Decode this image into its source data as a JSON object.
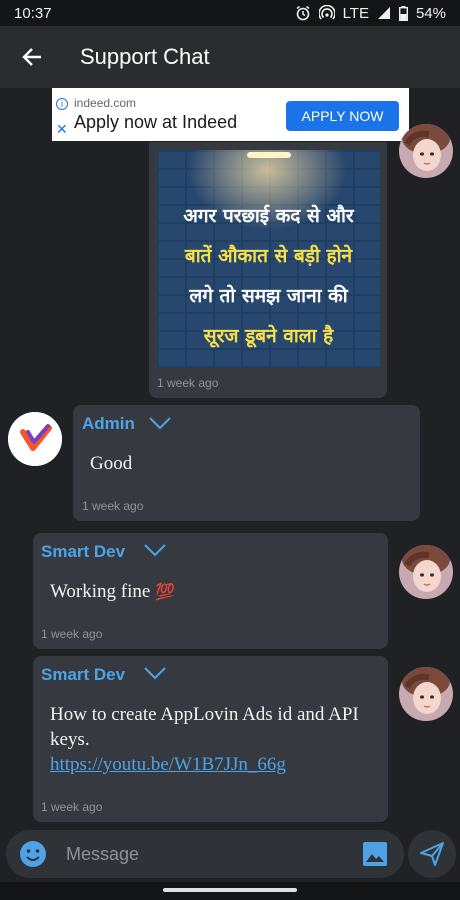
{
  "status_bar": {
    "time": "10:37",
    "network": "LTE",
    "battery": "54%"
  },
  "app_bar": {
    "title": "Support Chat"
  },
  "ad": {
    "domain": "indeed.com",
    "headline": "Apply now at Indeed",
    "cta": "APPLY NOW"
  },
  "messages": [
    {
      "image_text": [
        "अगर परछाई कद से और",
        "बातें औकात से बड़ी होने",
        "लगे तो समझ जाना की",
        "सूरज डूबने वाला है"
      ],
      "time": "1 week ago"
    },
    {
      "sender": "Admin",
      "text": "Good",
      "time": "1 week ago"
    },
    {
      "sender": "Smart Dev",
      "text": "Working fine",
      "emoji": "💯",
      "time": "1 week ago"
    },
    {
      "sender": "Smart Dev",
      "text": "How to create AppLovin Ads id and API keys.",
      "link": "https://youtu.be/W1B7JJn_66g",
      "time": "1 week ago"
    }
  ],
  "composer": {
    "placeholder": "Message"
  },
  "colors": {
    "accent": "#4ea3e6",
    "background": "#1f2124",
    "bubble": "#363a40",
    "poster_yellow": "#f5e04a"
  },
  "icons": [
    "back-arrow-icon",
    "alarm-icon",
    "hotspot-icon",
    "signal-icon",
    "battery-icon",
    "info-icon",
    "close-icon",
    "chevron-down-icon",
    "emoji-icon",
    "image-icon",
    "send-icon"
  ]
}
